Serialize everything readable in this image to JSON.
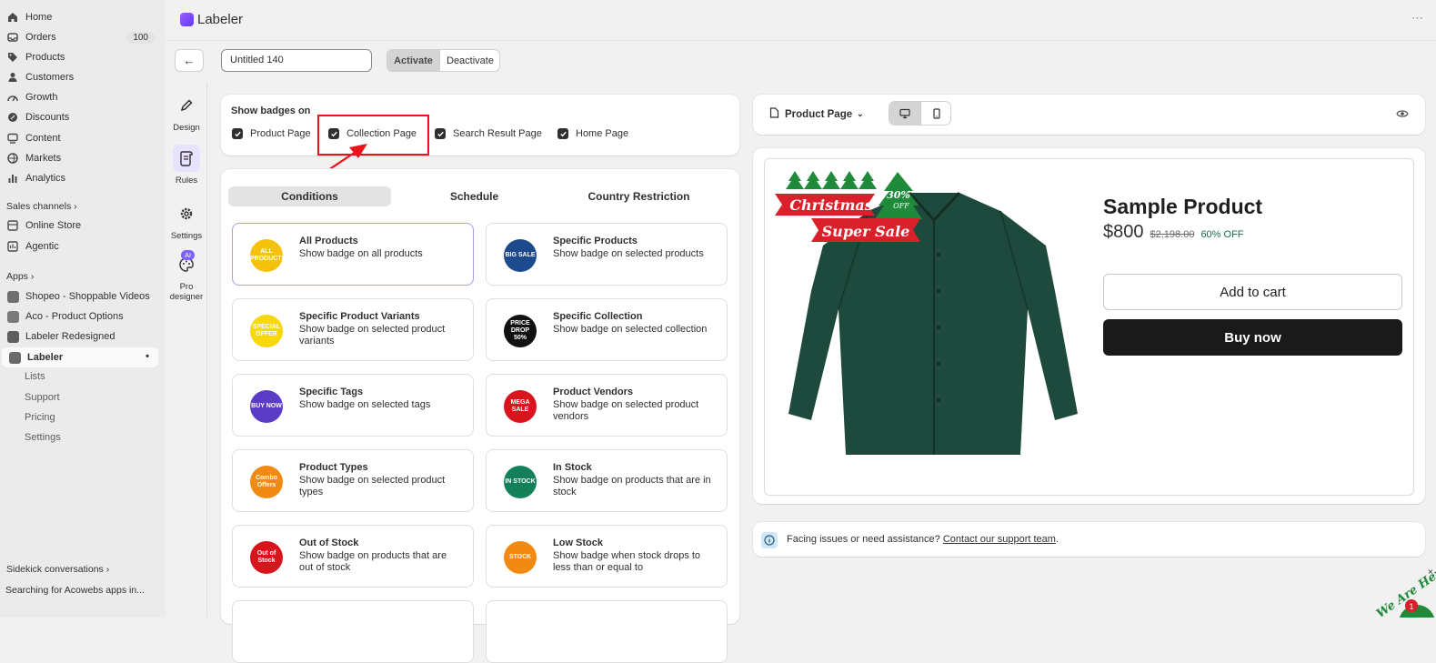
{
  "sidebar": {
    "items": [
      {
        "label": "Home",
        "icon": "home-icon"
      },
      {
        "label": "Orders",
        "icon": "orders-icon",
        "count": "100"
      },
      {
        "label": "Products",
        "icon": "tag-icon"
      },
      {
        "label": "Customers",
        "icon": "person-icon"
      },
      {
        "label": "Growth",
        "icon": "growth-icon"
      },
      {
        "label": "Discounts",
        "icon": "discount-icon"
      },
      {
        "label": "Content",
        "icon": "content-icon"
      },
      {
        "label": "Markets",
        "icon": "globe-icon"
      },
      {
        "label": "Analytics",
        "icon": "bar-chart-icon"
      }
    ],
    "sales_channels_label": "Sales channels",
    "channels": [
      {
        "label": "Online Store"
      },
      {
        "label": "Agentic"
      }
    ],
    "apps_label": "Apps",
    "apps": [
      {
        "label": "Shopeo - Shoppable Videos"
      },
      {
        "label": "Aco - Product Options"
      },
      {
        "label": "Labeler Redesigned"
      },
      {
        "label": "Labeler"
      }
    ],
    "labeler_sub": [
      "Lists",
      "Support",
      "Pricing",
      "Settings"
    ],
    "sidekick_label": "Sidekick conversations",
    "sidekick_item": "Searching for Acowebs apps in..."
  },
  "header": {
    "app_title": "Labeler",
    "more_label": "⋯"
  },
  "toolbar": {
    "back_label": "←",
    "name_value": "Untitled 140",
    "activate_label": "Activate",
    "deactivate_label": "Deactivate"
  },
  "rail": {
    "items": [
      {
        "label": "Design",
        "icon": "pencil-icon"
      },
      {
        "label": "Rules",
        "icon": "rules-icon"
      },
      {
        "label": "Settings",
        "icon": "gear-icon"
      },
      {
        "label": "Pro\ndesigner",
        "icon": "palette-icon",
        "badge": "AI"
      }
    ]
  },
  "show_badges": {
    "title": "Show badges on",
    "options": [
      {
        "label": "Product Page",
        "checked": true
      },
      {
        "label": "Collection Page",
        "checked": true
      },
      {
        "label": "Search Result Page",
        "checked": true
      },
      {
        "label": "Home Page",
        "checked": true
      }
    ]
  },
  "tabs": [
    "Conditions",
    "Schedule",
    "Country Restriction"
  ],
  "conditions": [
    {
      "title": "All Products",
      "desc": "Show badge on all products",
      "thumb_text": "ALL PRODUCTS",
      "color": "#f4c20d"
    },
    {
      "title": "Specific Products",
      "desc": "Show badge on selected products",
      "thumb_text": "BIG SALE",
      "color": "#1d4a8c"
    },
    {
      "title": "Specific Product Variants",
      "desc": "Show badge on selected product variants",
      "thumb_text": "SPECIAL OFFER",
      "color": "#f6d80b"
    },
    {
      "title": "Specific Collection",
      "desc": "Show badge on selected collection",
      "thumb_text": "PRICE DROP 50%",
      "color": "#111111"
    },
    {
      "title": "Specific Tags",
      "desc": "Show badge on selected tags",
      "thumb_text": "BUY NOW",
      "color": "#5b3cc4"
    },
    {
      "title": "Product Vendors",
      "desc": "Show badge on selected product vendors",
      "thumb_text": "MEGA SALE",
      "color": "#d8141c"
    },
    {
      "title": "Product Types",
      "desc": "Show badge on selected product types",
      "thumb_text": "Combo Offers",
      "color": "#f08a12"
    },
    {
      "title": "In Stock",
      "desc": "Show badge on products that are in stock",
      "thumb_text": "IN STOCK",
      "color": "#13805a"
    },
    {
      "title": "Out of Stock",
      "desc": "Show badge on products that are out of stock",
      "thumb_text": "Out of Stock",
      "color": "#d8141c"
    },
    {
      "title": "Low Stock",
      "desc": "Show badge when stock drops to less than or equal to",
      "thumb_text": "STOCK",
      "color": "#f08a12"
    }
  ],
  "preview": {
    "page_select": "Product Page",
    "desktop_icon": "desktop-icon",
    "mobile_icon": "mobile-icon",
    "eye_icon": "eye-icon",
    "product_title": "Sample Product",
    "price": "$800",
    "compare_price": "$2,198.00",
    "discount": "60% OFF",
    "add_to_cart": "Add to cart",
    "buy_now": "Buy now",
    "badge_line1": "Christmas",
    "badge_line2": "Super Sale",
    "badge_pct": "30%",
    "badge_off": "OFF"
  },
  "help": {
    "text": "Facing issues or need assistance?",
    "link": "Contact our support team",
    "suffix": "."
  },
  "chat": {
    "label": "We Are Here",
    "count": "1"
  },
  "colors": {
    "annotation_red": "#e8141c",
    "badge_red": "#d9202b",
    "tree_green": "#1f8a3a",
    "shirt": "#1e4a3d",
    "accent_purple": "#7b61ff"
  }
}
